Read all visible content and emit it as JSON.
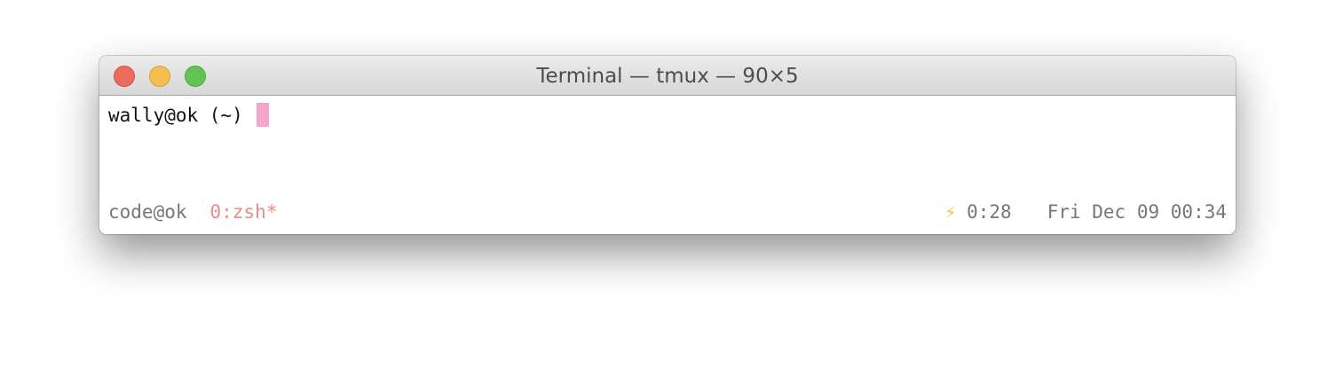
{
  "window": {
    "title": "Terminal — tmux — 90×5"
  },
  "terminal": {
    "prompt": "wally@ok (~) "
  },
  "tmux_status": {
    "session": "code@ok",
    "window_list": "0:zsh*",
    "bolt_icon": "⚡",
    "battery_time": "0:28",
    "datetime": "Fri Dec 09 00:34"
  },
  "colors": {
    "cursor": "#f6a6cb",
    "active_window": "#ec8a8a",
    "bolt": "#f2c344",
    "traffic_close": "#ed6a5e",
    "traffic_minimize": "#f5bf4f",
    "traffic_zoom": "#61c454"
  }
}
